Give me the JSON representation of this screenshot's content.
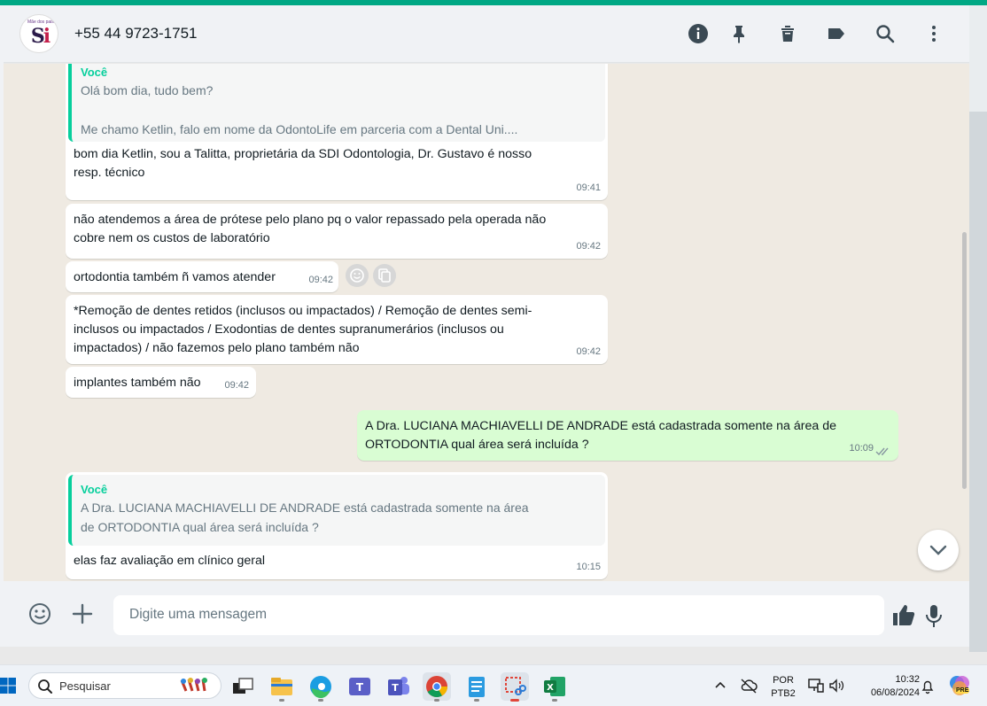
{
  "header": {
    "avatar_tiny": "Mãe dos pais",
    "avatar_logo": "S",
    "avatar_logo_accent": "i",
    "contact": "+55 44 9723-1751",
    "icons": [
      "info-icon",
      "pin-icon",
      "delete-icon",
      "label-icon",
      "search-icon",
      "menu-icon"
    ]
  },
  "messages": [
    {
      "quote_author": "Você",
      "quote_text": "Olá bom dia, tudo bem?\n\nMe chamo Ketlin, falo em nome da OdontoLife em parceria com a Dental Uni....",
      "text": "bom dia Ketlin, sou a Talitta, proprietária da SDI Odontologia, Dr. Gustavo é nosso\nresp. técnico",
      "time": "09:41"
    },
    {
      "text": "não atendemos a área de prótese pelo plano pq o valor repassado pela operada não\ncobre nem os custos de laboratório",
      "time": "09:42"
    },
    {
      "text": "ortodontia também ñ vamos atender",
      "time": "09:42"
    },
    {
      "text": "*Remoção de dentes retidos (inclusos ou impactados) /  Remoção de dentes semi-\ninclusos ou  impactados /  Exodontias de dentes supranumerários (inclusos ou\nimpactados) / não fazemos pelo plano também não",
      "time": "09:42"
    },
    {
      "text": "implantes também não",
      "time": "09:42"
    },
    {
      "text": "A Dra. LUCIANA MACHIAVELLI DE ANDRADE está cadastrada somente na área de\nORTODONTIA qual área será incluída ?",
      "time": "10:09",
      "outgoing": true
    },
    {
      "quote_author": "Você",
      "quote_text": "A Dra. LUCIANA MACHIAVELLI DE ANDRADE está cadastrada somente na área\nde ORTODONTIA qual área será incluída ?",
      "text": "elas faz avaliação em clínico geral",
      "time": "10:15"
    }
  ],
  "composer": {
    "placeholder": "Digite uma mensagem"
  },
  "taskbar": {
    "search_placeholder": "Pesquisar",
    "lang": "POR",
    "layout": "PTB2",
    "time": "10:32",
    "date": "06/08/2024",
    "copilot_badge": "PRE"
  },
  "colors": {
    "accent": "#00a884",
    "outgoing_bubble": "#d9fdd3",
    "quote_bar": "#06cf9c",
    "chat_bg": "#efeae2"
  }
}
